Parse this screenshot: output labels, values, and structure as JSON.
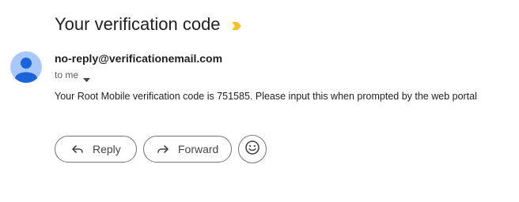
{
  "email": {
    "subject": "Your verification code",
    "importance_marker": "important-marker-icon",
    "sender": "no-reply@verificationemail.com",
    "recipient_label": "to me",
    "body": "Your Root Mobile verification code is 751585. Please input this when prompted by the web portal"
  },
  "actions": {
    "reply_label": "Reply",
    "forward_label": "Forward",
    "reply_icon": "reply-arrow-icon",
    "forward_icon": "forward-arrow-icon",
    "emoji_icon": "smiley-icon"
  },
  "colors": {
    "importance_marker": "#f6c026",
    "avatar_background": "#a8c7fa",
    "avatar_figure": "#1a63d8",
    "button_border": "#747775",
    "secondary_text": "#5e5e5e"
  }
}
